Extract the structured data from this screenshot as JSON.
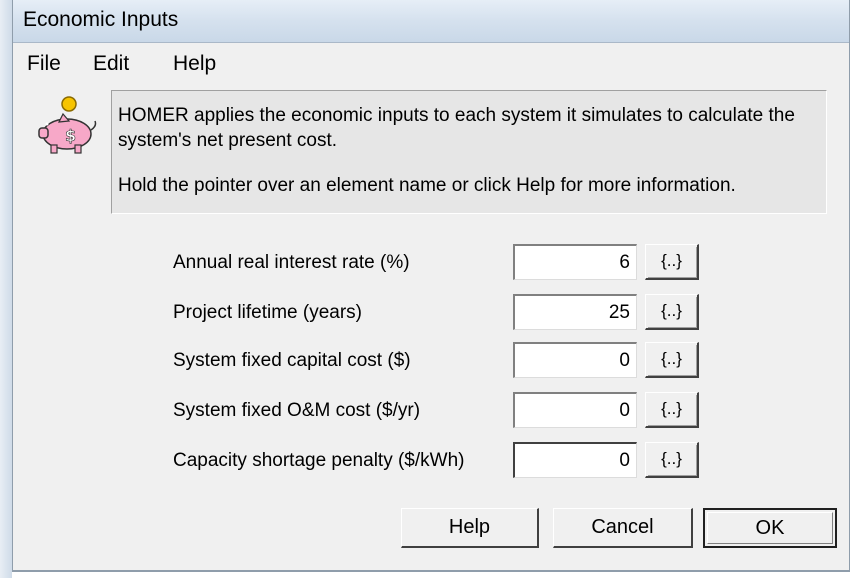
{
  "window": {
    "title": "Economic Inputs"
  },
  "menu": {
    "file": "File",
    "edit": "Edit",
    "help": "Help"
  },
  "info": {
    "icon": "piggy-bank-icon",
    "line1": "HOMER applies the economic inputs to each system it simulates to calculate the system's net present cost.",
    "line2": "Hold the pointer over an element name or click Help for more information."
  },
  "fields": [
    {
      "label": "Annual real interest rate (%)",
      "value": "6",
      "sensitivity_label": "{..}"
    },
    {
      "label": "Project lifetime (years)",
      "value": "25",
      "sensitivity_label": "{..}"
    },
    {
      "label": "System fixed capital cost ($)",
      "value": "0",
      "sensitivity_label": "{..}"
    },
    {
      "label": "System fixed O&M cost ($/yr)",
      "value": "0",
      "sensitivity_label": "{..}"
    },
    {
      "label": "Capacity shortage penalty ($/kWh)",
      "value": "0",
      "sensitivity_label": "{..}"
    }
  ],
  "buttons": {
    "help": "Help",
    "cancel": "Cancel",
    "ok": "OK"
  },
  "colors": {
    "dialog_background": "#f0f0f0",
    "info_background": "#e6e6e6",
    "title_bar": "#d5e1ee"
  }
}
